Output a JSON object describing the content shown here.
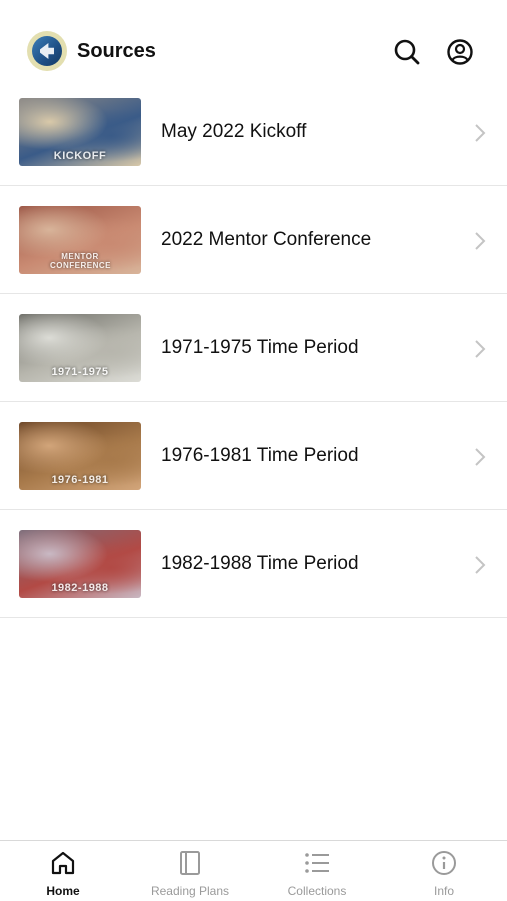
{
  "header": {
    "title": "Sources",
    "logo_icon": "book-logo-icon",
    "search_icon": "search-icon",
    "account_icon": "account-icon"
  },
  "sources": [
    {
      "label": "May 2022 Kickoff",
      "thumb_caption": "KICKOFF",
      "thumb_colors": [
        "#8e8a86",
        "#3a5b88",
        "#d9c9a9"
      ]
    },
    {
      "label": "2022 Mentor Conference",
      "thumb_caption": "MENTOR CONFERENCE",
      "thumb_colors": [
        "#9a5545",
        "#c98a72",
        "#d8b49a"
      ]
    },
    {
      "label": "1971-1975 Time Period",
      "thumb_caption": "1971-1975",
      "thumb_colors": [
        "#6c6c66",
        "#b7b6ad",
        "#dcdcd6"
      ]
    },
    {
      "label": "1976-1981 Time Period",
      "thumb_caption": "1976-1981",
      "thumb_colors": [
        "#6a4426",
        "#a87a4b",
        "#d2a57a"
      ]
    },
    {
      "label": "1982-1988 Time Period",
      "thumb_caption": "1982-1988",
      "thumb_colors": [
        "#7b6b78",
        "#b24a45",
        "#c9b9c4"
      ]
    }
  ],
  "tabs": [
    {
      "label": "Home",
      "icon": "home-icon",
      "active": true
    },
    {
      "label": "Reading Plans",
      "icon": "book-icon",
      "active": false
    },
    {
      "label": "Collections",
      "icon": "list-icon",
      "active": false
    },
    {
      "label": "Info",
      "icon": "info-icon",
      "active": false
    }
  ]
}
